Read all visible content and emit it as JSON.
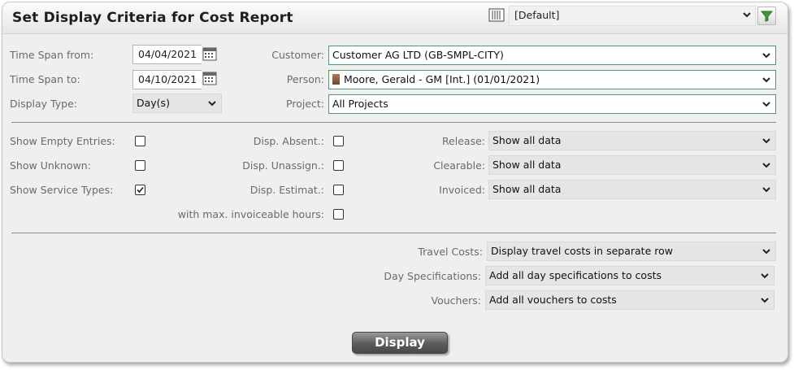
{
  "window": {
    "title": "Set Display Criteria for Cost Report"
  },
  "toolbar": {
    "layout_selected": "[Default]"
  },
  "time_span_from": {
    "label": "Time Span from:",
    "value": "04/04/2021"
  },
  "time_span_to": {
    "label": "Time Span to:",
    "value": "04/10/2021"
  },
  "display_type": {
    "label": "Display Type:",
    "value": "Day(s)"
  },
  "customer": {
    "label": "Customer:",
    "value": "Customer AG LTD (GB-SMPL-CITY)"
  },
  "person": {
    "label": "Person:",
    "value": "Moore, Gerald - GM [Int.] (01/01/2021)"
  },
  "project": {
    "label": "Project:",
    "value": "All Projects"
  },
  "options": {
    "show_empty_entries": {
      "label": "Show Empty Entries:",
      "checked": false
    },
    "show_unknown": {
      "label": "Show Unknown:",
      "checked": false
    },
    "show_service_types": {
      "label": "Show Service Types:",
      "checked": true
    },
    "disp_absent": {
      "label": "Disp. Absent.:",
      "checked": false
    },
    "disp_unassign": {
      "label": "Disp. Unassign.:",
      "checked": false
    },
    "disp_estimat": {
      "label": "Disp. Estimat.:",
      "checked": false
    },
    "max_invoiceable": {
      "label": "with max. invoiceable hours:",
      "checked": false
    }
  },
  "release": {
    "label": "Release:",
    "value": "Show all data"
  },
  "clearable": {
    "label": "Clearable:",
    "value": "Show all data"
  },
  "invoiced": {
    "label": "Invoiced:",
    "value": "Show all data"
  },
  "travel_costs": {
    "label": "Travel Costs:",
    "value": "Display travel costs in separate row"
  },
  "day_specifications": {
    "label": "Day Specifications:",
    "value": "Add all day specifications to costs"
  },
  "vouchers": {
    "label": "Vouchers:",
    "value": "Add all vouchers to costs"
  },
  "actions": {
    "display_label": "Display"
  }
}
